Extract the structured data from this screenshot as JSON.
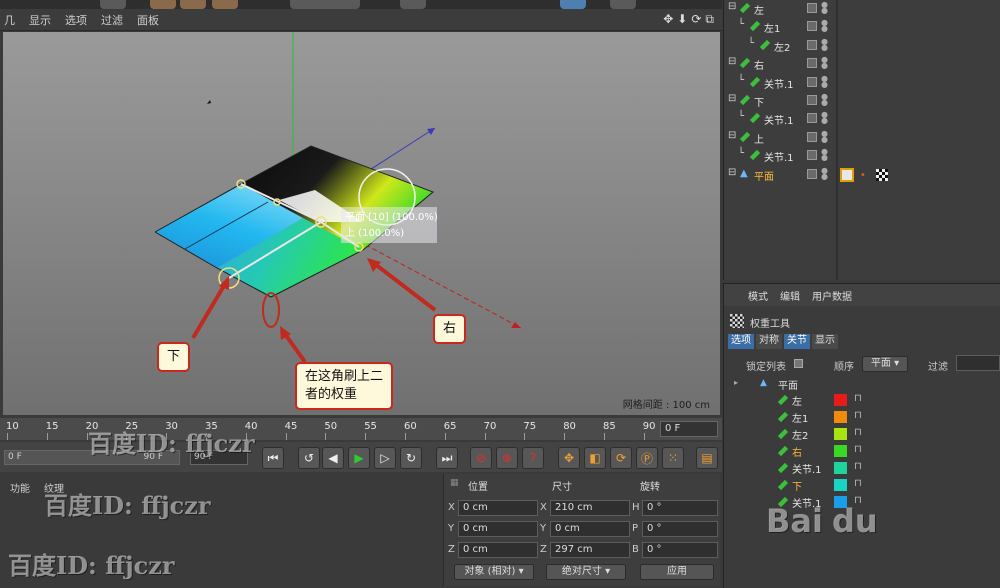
{
  "viewport_menu": {
    "cut_item": "几",
    "items": [
      "显示",
      "选项",
      "过滤",
      "面板"
    ],
    "nav_icons": [
      "✥",
      "⬇",
      "⟳",
      "⧉"
    ]
  },
  "viewport": {
    "grid_spacing": "网格间距 : 100 cm",
    "tooltip_line1": "平面 [10] (100.0%)",
    "tooltip_line2": "上 (100.0%)"
  },
  "callouts": {
    "down": "下",
    "right": "右",
    "corner_line1": "在这角刷上二",
    "corner_line2": "者的权重"
  },
  "timeline": {
    "ticks": [
      "10",
      "15",
      "20",
      "25",
      "30",
      "35",
      "40",
      "45",
      "50",
      "55",
      "60",
      "65",
      "70",
      "75",
      "80",
      "85",
      "90"
    ],
    "current_frame": "0 F",
    "start_field": "0 F",
    "end_field": "90 F",
    "max_field": "90 F"
  },
  "bottom_left": {
    "tab_func": "功能",
    "tab_tex": "纹理"
  },
  "coords": {
    "col_pos": "位置",
    "col_size": "尺寸",
    "col_rot": "旋转",
    "rows": [
      {
        "a": "X",
        "pos": "0 cm",
        "b": "X",
        "size": "210 cm",
        "c": "H",
        "rot": "0 °"
      },
      {
        "a": "Y",
        "pos": "0 cm",
        "b": "Y",
        "size": "0 cm",
        "c": "P",
        "rot": "0 °"
      },
      {
        "a": "Z",
        "pos": "0 cm",
        "b": "Z",
        "size": "297 cm",
        "c": "B",
        "rot": "0 °"
      }
    ],
    "mode_object": "对象 (相对)",
    "mode_size": "绝对尺寸",
    "apply": "应用"
  },
  "objects": [
    {
      "name": "左",
      "indent": 0,
      "hl": false
    },
    {
      "name": "左1",
      "indent": 1,
      "hl": false
    },
    {
      "name": "左2",
      "indent": 2,
      "hl": false
    },
    {
      "name": "右",
      "indent": 0,
      "hl": false
    },
    {
      "name": "关节.1",
      "indent": 1,
      "hl": false
    },
    {
      "name": "下",
      "indent": 0,
      "hl": false
    },
    {
      "name": "关节.1",
      "indent": 1,
      "hl": false
    },
    {
      "name": "上",
      "indent": 0,
      "hl": false
    },
    {
      "name": "关节.1",
      "indent": 1,
      "hl": false
    },
    {
      "name": "平面",
      "indent": 0,
      "hl": true
    }
  ],
  "attributes": {
    "menu": [
      "模式",
      "编辑",
      "用户数据"
    ],
    "tool_name": "权重工具",
    "tabs": [
      "选项",
      "对称",
      "关节",
      "显示"
    ],
    "lock_list": "锁定列表",
    "order_label": "顺序",
    "order_value": "平面",
    "filter_label": "过滤",
    "root": "平面",
    "weights": [
      {
        "name": "左",
        "color": "#e81b1b",
        "hl": false
      },
      {
        "name": "左1",
        "color": "#f28a0e",
        "hl": false
      },
      {
        "name": "左2",
        "color": "#a8e40f",
        "hl": false
      },
      {
        "name": "右",
        "color": "#3ad826",
        "hl": true
      },
      {
        "name": "关节.1",
        "color": "#1ed49a",
        "hl": false
      },
      {
        "name": "下",
        "color": "#17d4c5",
        "hl": true
      },
      {
        "name": "关节.1",
        "color": "#1a9ee8",
        "hl": false
      }
    ]
  },
  "watermarks": [
    "百度ID: ffjczr",
    "百度ID: ffjczr",
    "百度ID: ffjczr",
    "Bai",
    "du"
  ]
}
